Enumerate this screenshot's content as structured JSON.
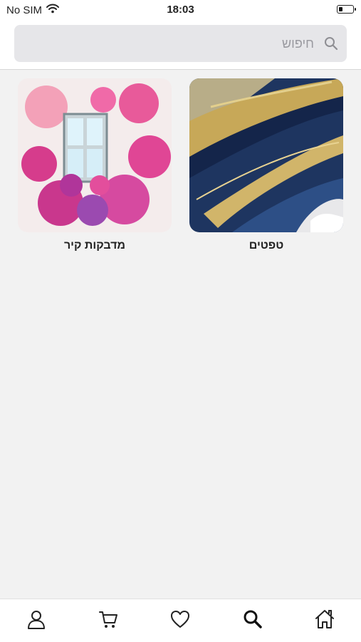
{
  "status_bar": {
    "carrier": "No SIM",
    "time": "18:03",
    "battery_level_percent": 30,
    "icons": [
      "wifi-icon",
      "battery-icon"
    ]
  },
  "search": {
    "placeholder": "חיפוש",
    "value": "",
    "icon": "search-icon"
  },
  "categories": [
    {
      "label": "טפטים",
      "image": "abstract navy blue and gold paint strokes"
    },
    {
      "label": "מדבקות קיר",
      "image": "watercolor window with pink bougainvillea flowers"
    }
  ],
  "tab_bar": {
    "items": [
      {
        "icon": "home-icon"
      },
      {
        "icon": "search-icon",
        "active": true
      },
      {
        "icon": "heart-icon"
      },
      {
        "icon": "cart-icon"
      },
      {
        "icon": "user-icon"
      }
    ]
  },
  "colors": {
    "background": "#f2f2f2",
    "search_field": "#e6e6e9",
    "text": "#222222"
  }
}
